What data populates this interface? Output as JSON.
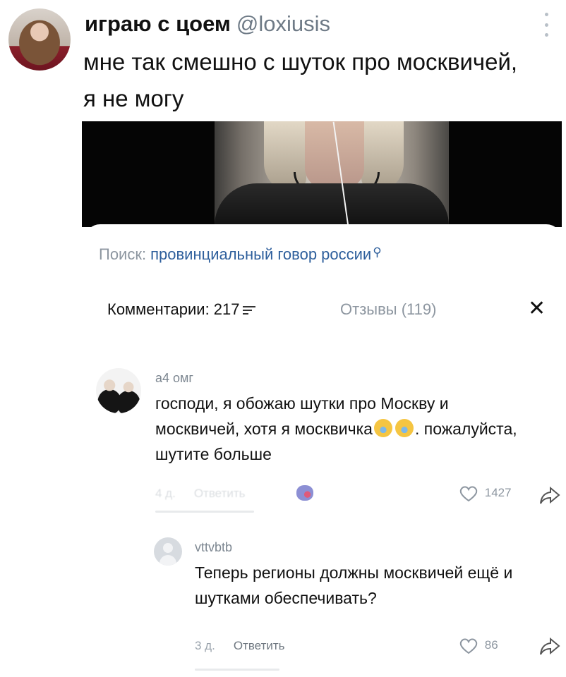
{
  "post": {
    "author_name": "играю с цоем",
    "author_handle": "@loxiusis",
    "text": "мне так смешно с шуток про москвичей, я не могу"
  },
  "sheet": {
    "search_label": "Поиск:",
    "search_query": "провинциальный говор россии",
    "tabs": {
      "comments": "Комментарии: 217",
      "reviews": "Отзывы (119)"
    }
  },
  "comments": [
    {
      "author": "а4 омг",
      "text_part1": "господи, я обожаю шутки про Москву и москвичей, хотя я москвичка",
      "text_part2": ". пожалуйста, шутите больше",
      "time": "4 д.",
      "reply_label": "Ответить",
      "likes": "1427"
    },
    {
      "author": "vttvbtb",
      "text": "Теперь регионы должны москвичей ещё и шутками обеспечивать?",
      "time": "3 д.",
      "reply_label": "Ответить",
      "likes": "86"
    }
  ],
  "icons": {
    "emoji": "loudly-crying-face-emoji",
    "share": "share-arrow-icon",
    "like": "heart-icon",
    "close": "close-icon"
  }
}
